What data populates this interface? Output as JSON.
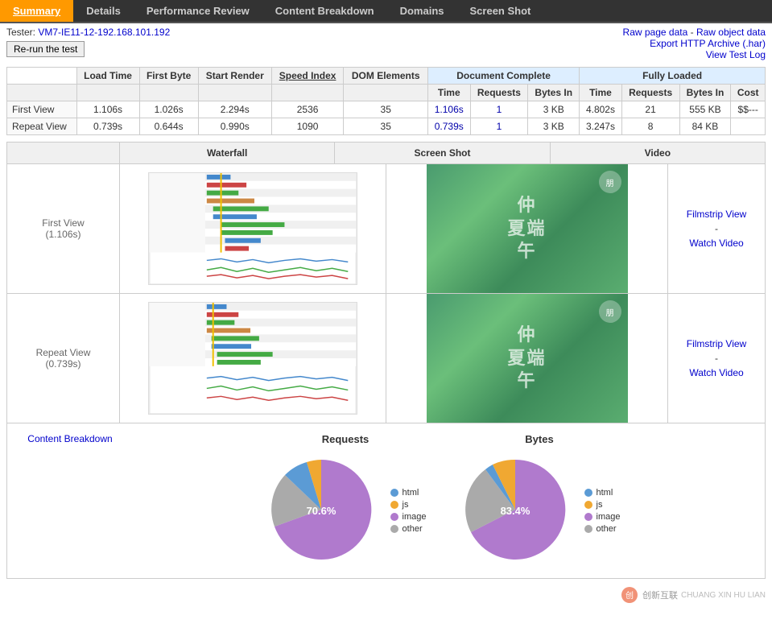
{
  "nav": {
    "items": [
      {
        "label": "Summary",
        "active": true
      },
      {
        "label": "Details",
        "active": false
      },
      {
        "label": "Performance Review",
        "active": false
      },
      {
        "label": "Content Breakdown",
        "active": false
      },
      {
        "label": "Domains",
        "active": false
      },
      {
        "label": "Screen Shot",
        "active": false
      }
    ]
  },
  "info": {
    "tester": "VM7-IE11-12-192.168.101.192",
    "rerun_label": "Re-run the test",
    "raw_page_data": "Raw page data",
    "raw_object_data": "Raw object data",
    "export_http": "Export HTTP Archive (.har)",
    "view_test_log": "View Test Log"
  },
  "table": {
    "headers": {
      "left": [
        "",
        "Load Time",
        "First Byte",
        "Start Render",
        "Speed Index",
        "DOM Elements"
      ],
      "doc_complete": "Document Complete",
      "doc_cols": [
        "Time",
        "Requests",
        "Bytes In"
      ],
      "fully_loaded": "Fully Loaded",
      "fully_cols": [
        "Time",
        "Requests",
        "Bytes In",
        "Cost"
      ]
    },
    "rows": [
      {
        "label": "First View",
        "load_time": "1.106s",
        "first_byte": "1.026s",
        "start_render": "2.294s",
        "speed_index": "2536",
        "dom_elements": "35",
        "doc_time": "1.106s",
        "doc_requests": "1",
        "doc_bytes": "3 KB",
        "fl_time": "4.802s",
        "fl_requests": "21",
        "fl_bytes": "555 KB",
        "fl_cost": "$$---"
      },
      {
        "label": "Repeat View",
        "load_time": "0.739s",
        "first_byte": "0.644s",
        "start_render": "0.990s",
        "speed_index": "1090",
        "dom_elements": "35",
        "doc_time": "0.739s",
        "doc_requests": "1",
        "doc_bytes": "3 KB",
        "fl_time": "3.247s",
        "fl_requests": "8",
        "fl_bytes": "84 KB",
        "fl_cost": ""
      }
    ]
  },
  "views": {
    "headers": [
      "Waterfall",
      "Screen Shot",
      "Video"
    ],
    "rows": [
      {
        "label": "First View",
        "sublabel": "(1.106s)",
        "filmstrip": "Filmstrip View",
        "dash": "-",
        "watch": "Watch Video"
      },
      {
        "label": "Repeat View",
        "sublabel": "(0.739s)",
        "filmstrip": "Filmstrip View",
        "dash": "-",
        "watch": "Watch Video"
      }
    ]
  },
  "content_breakdown": {
    "link_label": "Content Breakdown",
    "requests_title": "Requests",
    "bytes_title": "Bytes",
    "legend": [
      {
        "label": "html",
        "color": "#5b9bd5"
      },
      {
        "label": "js",
        "color": "#f0a832"
      },
      {
        "label": "image",
        "color": "#b07acd"
      },
      {
        "label": "other",
        "color": "#aaa"
      }
    ],
    "requests_pct": "70.6%",
    "bytes_pct": "83.4%",
    "requests_data": [
      {
        "label": "html",
        "color": "#5b9bd5",
        "pct": 5
      },
      {
        "label": "js",
        "color": "#f0a832",
        "pct": 15
      },
      {
        "label": "image",
        "color": "#b07acd",
        "pct": 70.6
      },
      {
        "label": "other",
        "color": "#aaa",
        "pct": 9.4
      }
    ],
    "bytes_data": [
      {
        "label": "html",
        "color": "#5b9bd5",
        "pct": 2
      },
      {
        "label": "js",
        "color": "#f0a832",
        "pct": 5
      },
      {
        "label": "image",
        "color": "#b07acd",
        "pct": 83.4
      },
      {
        "label": "other",
        "color": "#aaa",
        "pct": 9.6
      }
    ]
  },
  "footer": {
    "brand": "创新互联",
    "brand_en": "CHUANG XIN HU LIAN"
  }
}
